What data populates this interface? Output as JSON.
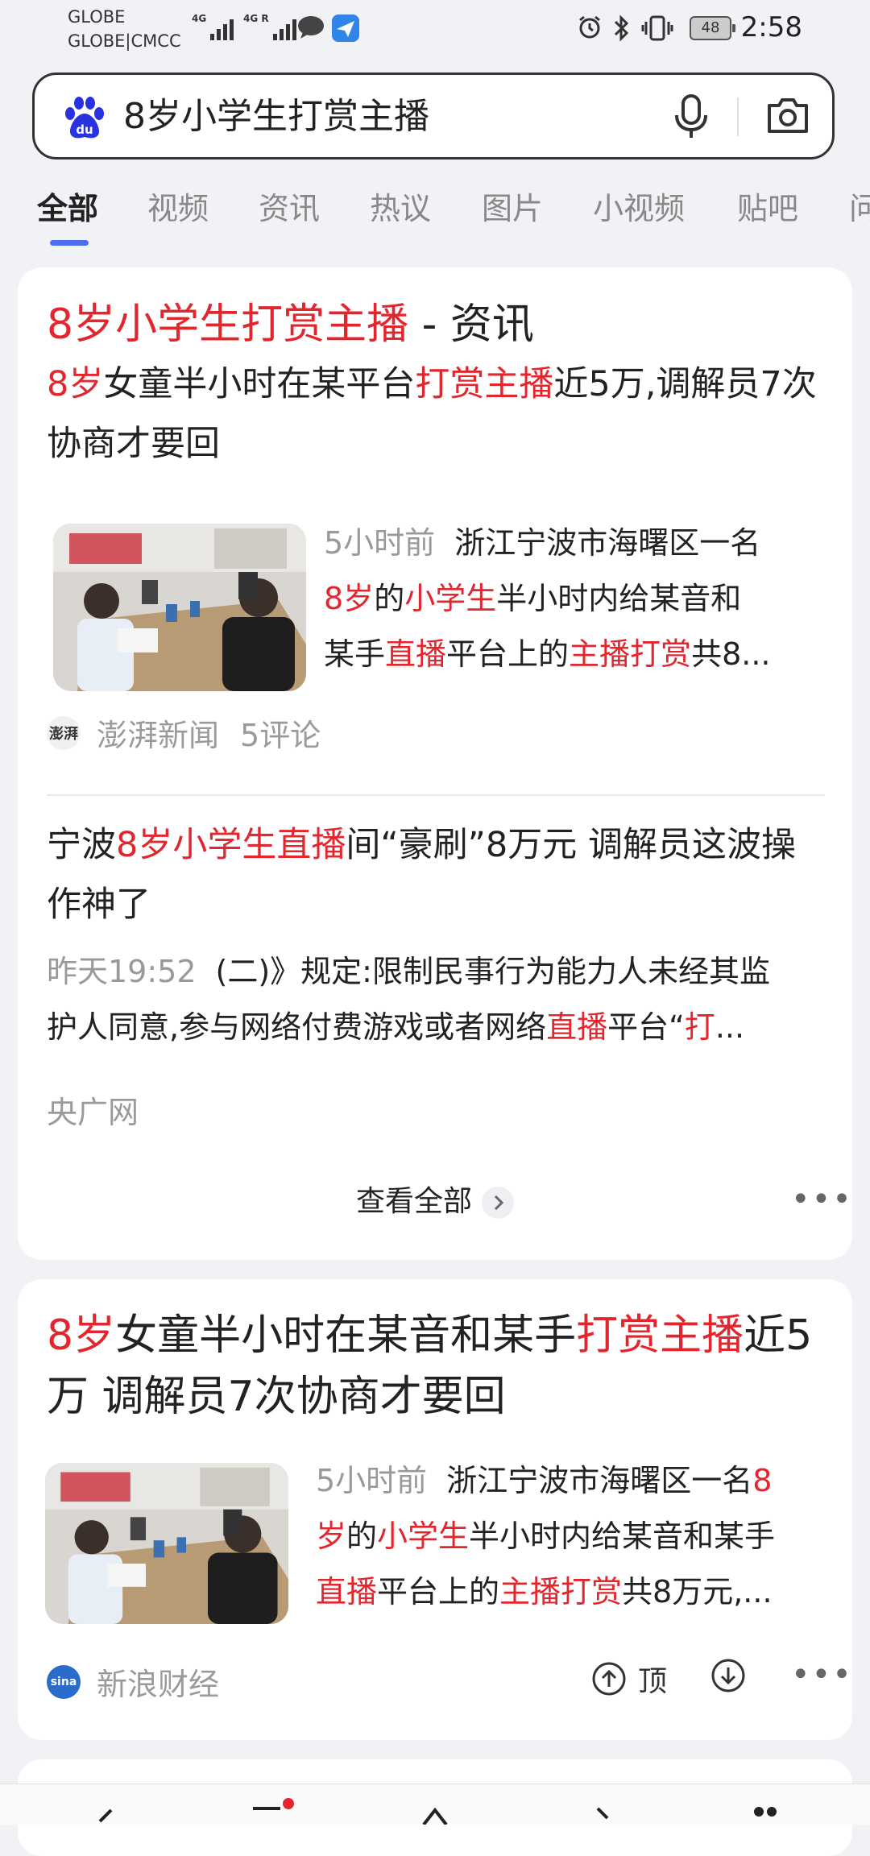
{
  "status_bar": {
    "carrier_1": "GLOBE",
    "carrier_2": "GLOBE|CMCC",
    "net_1": "4G",
    "net_2": "4G R",
    "battery": "48",
    "time": "2:58"
  },
  "search": {
    "query": "8岁小学生打赏主播"
  },
  "tabs": [
    "全部",
    "视频",
    "资讯",
    "热议",
    "图片",
    "小视频",
    "贴吧",
    "问"
  ],
  "card1": {
    "heading_red": "8岁小学生打赏主播",
    "heading_rest": " - 资讯",
    "item1": {
      "title_parts": [
        "8岁",
        "女童半小时在某平台",
        "打赏主播",
        "近5万,调解员7次协商才要回"
      ],
      "time": "5小时前",
      "line1": "浙江宁波市海曙区一名",
      "line2_parts": [
        "8岁",
        "的",
        "小学生",
        "半小时内给某音和"
      ],
      "line3_parts": [
        "某手",
        "直播",
        "平台上的",
        "主播打赏",
        "共8..."
      ],
      "source": "澎湃新闻",
      "comments": "5评论"
    },
    "item2": {
      "title_parts": [
        "宁波",
        "8岁小学生直播",
        "间“豪刷”8万元 调解员这波操作神了"
      ],
      "time": "昨天19:52",
      "line1": "(二)》规定:限制民事行为能力人未经其监",
      "line2_parts": [
        "护人同意,参与网络付费游戏或者网络",
        "直播",
        "平台“",
        "打",
        "..."
      ],
      "source": "央广网"
    },
    "view_all": "查看全部"
  },
  "card2": {
    "title_parts": [
      "8岁",
      "女童半小时在某音和某手",
      "打赏主播",
      "近5万 调解员7次协商才要回"
    ],
    "time": "5小时前",
    "line1_parts": [
      "浙江宁波市海曙区一名",
      "8"
    ],
    "line2_parts": [
      "岁",
      "的",
      "小学生",
      "半小时内给某音和某手"
    ],
    "line3_parts": [
      "直播",
      "平台上的",
      "主播打赏",
      "共8万元,..."
    ],
    "source": "新浪财经",
    "upvote": "顶"
  },
  "colors": {
    "highlight": "#e3262e",
    "accent": "#4e6ef2",
    "background": "#f1f2f5"
  }
}
